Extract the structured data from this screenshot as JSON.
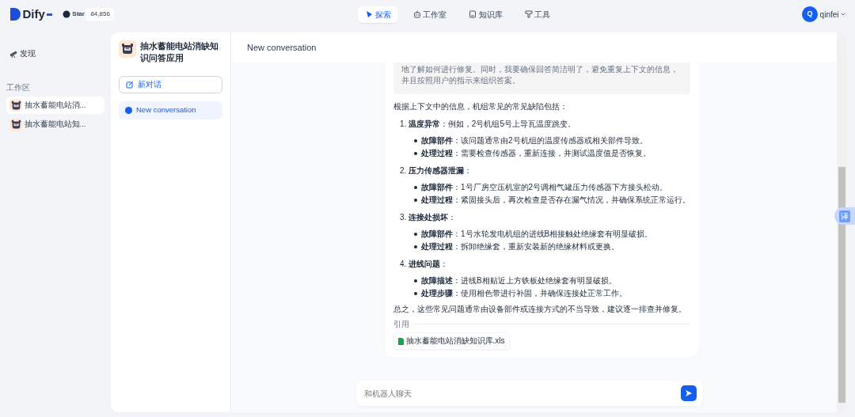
{
  "brand": {
    "name": "Dify",
    "github_label": "Star",
    "github_count": "84,856"
  },
  "nav": [
    {
      "label": "探索",
      "selected": true
    },
    {
      "label": "工作室",
      "selected": false
    },
    {
      "label": "知识库",
      "selected": false
    },
    {
      "label": "工具",
      "selected": false
    }
  ],
  "user": {
    "initial": "Q",
    "name": "qinfei"
  },
  "sidebar": {
    "discover": "发现",
    "section": "工作区",
    "apps": [
      {
        "name": "抽水蓄能电站消...",
        "selected": true
      },
      {
        "name": "抽水蓄能电站知...",
        "selected": false
      }
    ]
  },
  "app_panel": {
    "title": "抽水蓄能电站消缺知识问答应用",
    "new_chat": "新对话",
    "conversations": [
      {
        "title": "New conversation",
        "selected": true
      }
    ]
  },
  "chat": {
    "title": "New conversation",
    "thought": "地了解如何进行修复。同时，我要确保回答简洁明了，避免重复上下文的信息，并且按照用户的指示来组织答案。",
    "intro": "根据上下文中的信息，机组常见的常见缺陷包括：",
    "items": [
      {
        "number": "1.",
        "heading": "**温度异常**：例如，2号机组5号上导瓦温度跳变。",
        "bullets": [
          "**故障部件**：该问题通常由2号机组的温度传感器或相关部件导致。",
          "**处理过程**：需要检查传感器，重新连接，并测试温度值是否恢复。"
        ]
      },
      {
        "number": "2.",
        "heading": "**压力传感器泄漏**：",
        "bullets": [
          "**故障部件**：1号厂房空压机室的2号调相气罐压力传感器下方接头松动。",
          "**处理过程**：紧固接头后，再次检查是否存在漏气情况，并确保系统正常运行。"
        ]
      },
      {
        "number": "3.",
        "heading": "**连接处损坏**：",
        "bullets": [
          "**故障部件**：1号水轮发电机组的进线B相接触处绝缘套有明显破损。",
          "**处理过程**：拆卸绝缘套，重新安装新的绝缘材料或更换。"
        ]
      },
      {
        "number": "4.",
        "heading": "**进线问题**：",
        "bullets": [
          "**故障描述**：进线B相贴近上方铁板处绝缘套有明显破损。",
          "**处理步骤**：使用相色带进行补固，并确保连接处正常工作。"
        ]
      }
    ],
    "summary": "总之，这些常见问题通常由设备部件或连接方式的不当导致，建议逐一排查并修复。",
    "citation_label": "引用",
    "citations": [
      {
        "name": "抽水蓄能电站消缺知识库.xls"
      }
    ],
    "input": {
      "placeholder": "和机器人聊天"
    }
  },
  "translate": {
    "label": "译"
  }
}
